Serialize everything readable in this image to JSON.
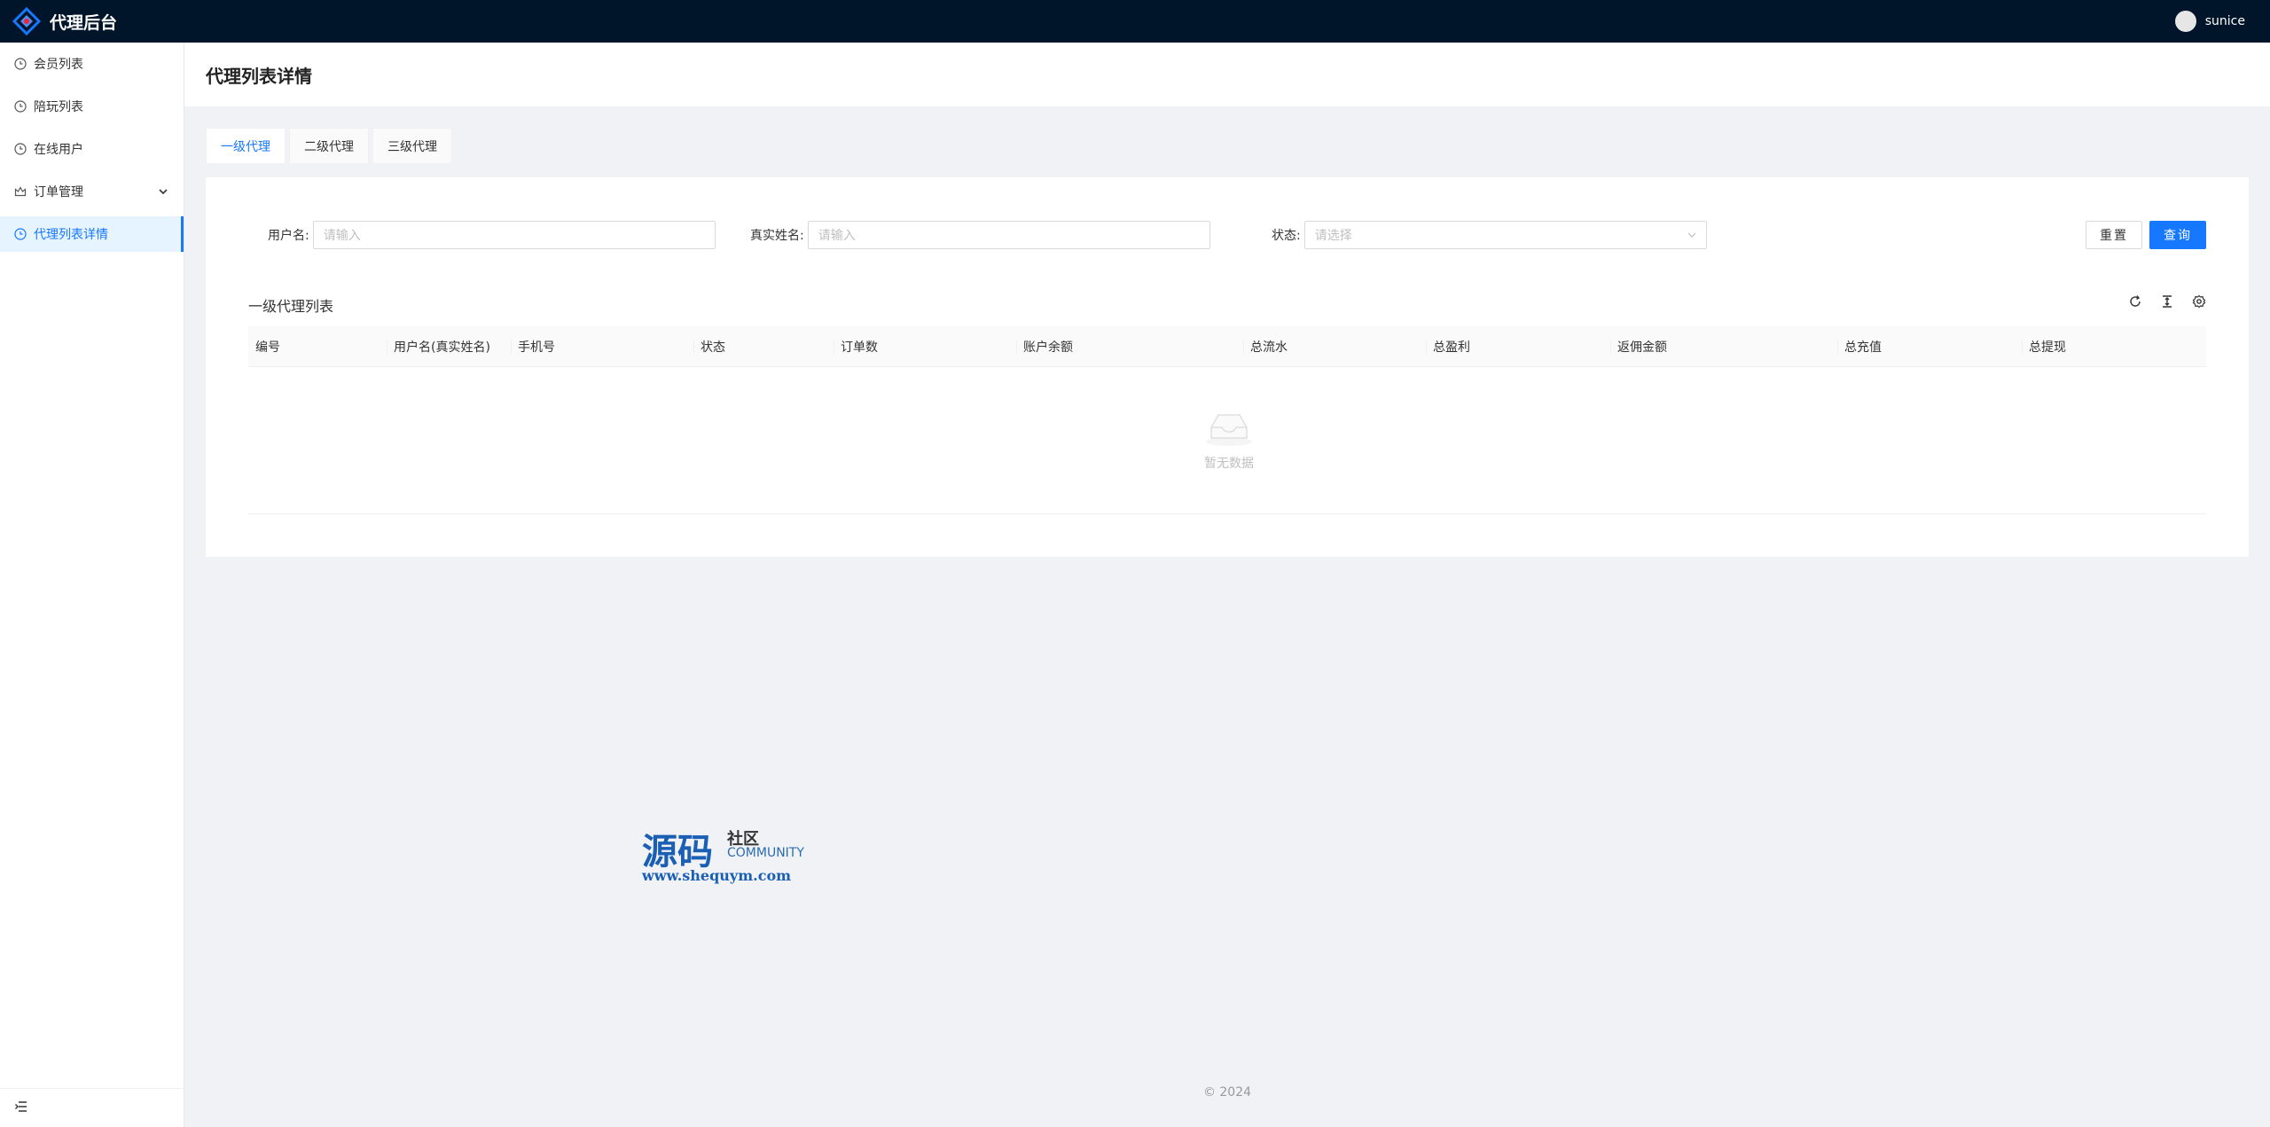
{
  "app": {
    "title": "代理后台",
    "username": "sunice"
  },
  "sidebar": {
    "items": [
      {
        "label": "会员列表",
        "icon": "clock-icon"
      },
      {
        "label": "陪玩列表",
        "icon": "clock-icon"
      },
      {
        "label": "在线用户",
        "icon": "clock-icon"
      },
      {
        "label": "订单管理",
        "icon": "crown-icon"
      },
      {
        "label": "代理列表详情",
        "icon": "clock-icon"
      }
    ],
    "active_index": 4
  },
  "page": {
    "title": "代理列表详情"
  },
  "tabs": [
    {
      "label": "一级代理"
    },
    {
      "label": "二级代理"
    },
    {
      "label": "三级代理"
    }
  ],
  "search": {
    "username_label": "用户名:",
    "username_placeholder": "请输入",
    "realname_label": "真实姓名:",
    "realname_placeholder": "请输入",
    "status_label": "状态:",
    "status_placeholder": "请选择",
    "reset_label": "重置",
    "query_label": "查询"
  },
  "table": {
    "title": "一级代理列表",
    "columns": [
      "编号",
      "用户名(真实姓名)",
      "手机号",
      "状态",
      "订单数",
      "账户余额",
      "总流水",
      "总盈利",
      "返佣金额",
      "总充值",
      "总提现"
    ],
    "empty_text": "暂无数据"
  },
  "watermark": {
    "big": "源码",
    "small": "社区",
    "community": "COMMUNITY",
    "url": "www.shequym.com"
  },
  "footer": {
    "text": "© 2024"
  },
  "colors": {
    "header": "#001529",
    "primary": "#1677ff"
  }
}
